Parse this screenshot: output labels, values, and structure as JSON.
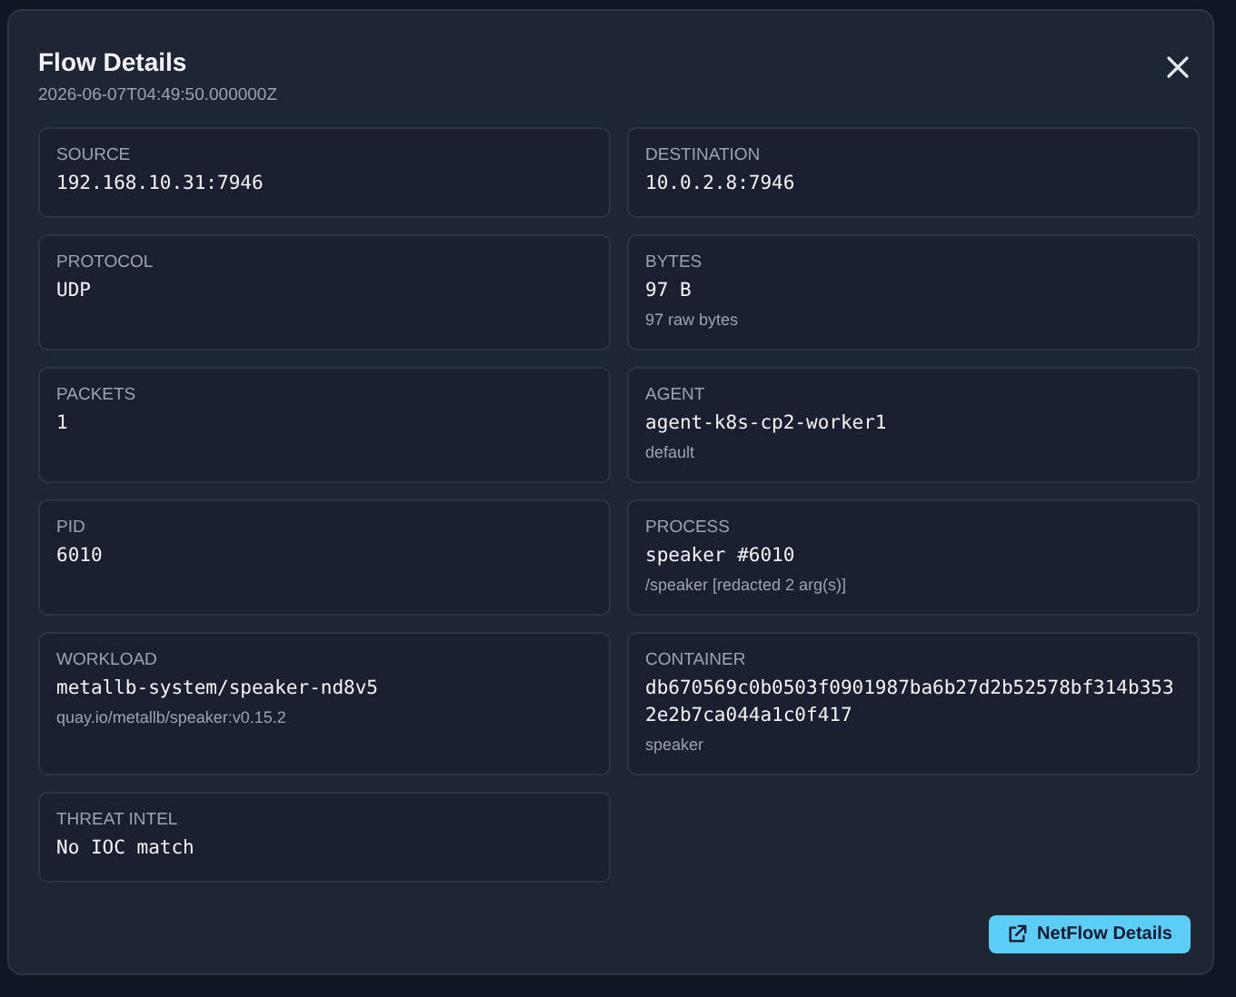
{
  "dialog": {
    "title": "Flow Details",
    "timestamp": "2026-06-07T04:49:50.000000Z"
  },
  "fields": [
    {
      "label": "SOURCE",
      "value": "192.168.10.31:7946"
    },
    {
      "label": "DESTINATION",
      "value": "10.0.2.8:7946"
    },
    {
      "label": "PROTOCOL",
      "value": "UDP"
    },
    {
      "label": "BYTES",
      "value": "97 B",
      "detail": "97 raw bytes"
    },
    {
      "label": "PACKETS",
      "value": "1"
    },
    {
      "label": "AGENT",
      "value": "agent-k8s-cp2-worker1",
      "detail": "default"
    },
    {
      "label": "PID",
      "value": "6010"
    },
    {
      "label": "PROCESS",
      "value": "speaker #6010",
      "detail": "/speaker [redacted 2 arg(s)]"
    },
    {
      "label": "WORKLOAD",
      "value": "metallb-system/speaker-nd8v5",
      "detail": "quay.io/metallb/speaker:v0.15.2"
    },
    {
      "label": "CONTAINER",
      "value": "db670569c0b0503f0901987ba6b27d2b52578bf314b3532e2b7ca044a1c0f417",
      "detail": "speaker"
    },
    {
      "label": "THREAT INTEL",
      "value": "No IOC match"
    }
  ],
  "buttons": [
    {
      "label": "NetFlow Details"
    }
  ]
}
